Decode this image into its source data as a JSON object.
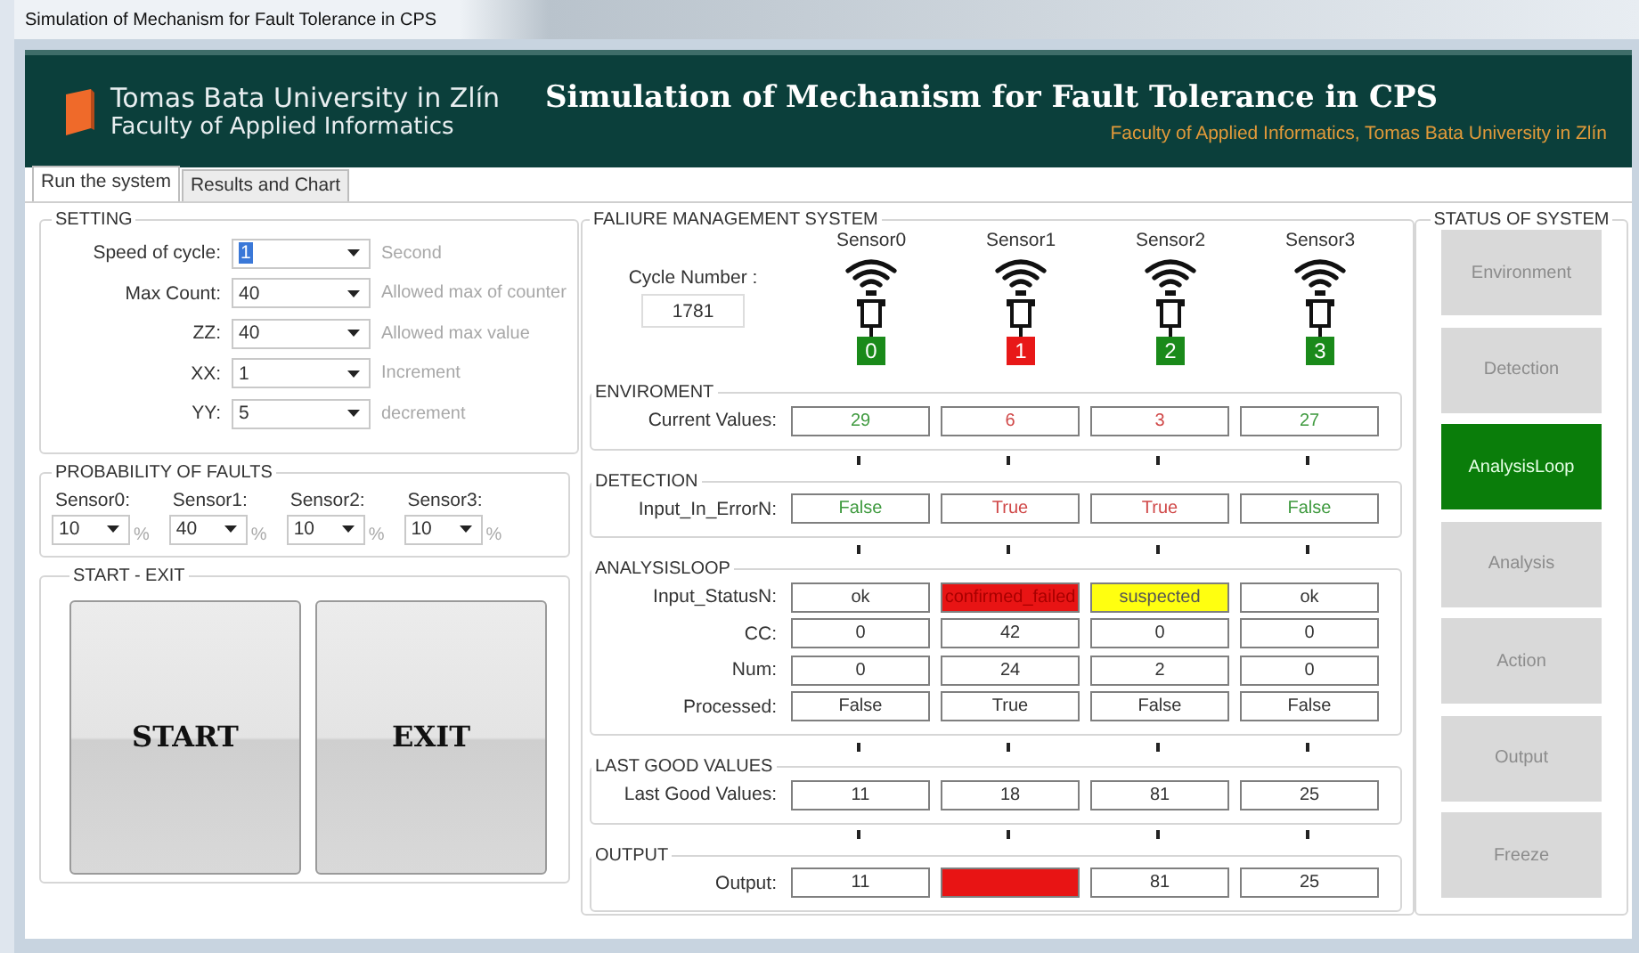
{
  "window": {
    "title": "Simulation of Mechanism for Fault Tolerance in CPS"
  },
  "header": {
    "university": "Tomas Bata University in Zlín",
    "faculty": "Faculty of Applied Informatics",
    "title": "Simulation of Mechanism for Fault Tolerance in CPS",
    "subtitle": "Faculty of Applied Informatics, Tomas Bata University in Zlín"
  },
  "tabs": [
    {
      "label": "Run the system",
      "selected": true
    },
    {
      "label": "Results and Chart",
      "selected": false
    }
  ],
  "setting": {
    "title": "SETTING",
    "fields": [
      {
        "label": "Speed of cycle:",
        "value": "1",
        "hint": "Second",
        "highlighted": true
      },
      {
        "label": "Max Count:",
        "value": "40",
        "hint": "Allowed max of counter",
        "highlighted": false
      },
      {
        "label": "ZZ:",
        "value": "40",
        "hint": "Allowed max value",
        "highlighted": false
      },
      {
        "label": "XX:",
        "value": "1",
        "hint": "Increment",
        "highlighted": false
      },
      {
        "label": "YY:",
        "value": "5",
        "hint": "decrement",
        "highlighted": false
      }
    ]
  },
  "probability": {
    "title": "PROBABILITY OF FAULTS",
    "sensors": [
      {
        "label": "Sensor0:",
        "value": "10",
        "unit": "%"
      },
      {
        "label": "Sensor1:",
        "value": "40",
        "unit": "%"
      },
      {
        "label": "Sensor2:",
        "value": "10",
        "unit": "%"
      },
      {
        "label": "Sensor3:",
        "value": "10",
        "unit": "%"
      }
    ]
  },
  "start_exit": {
    "title": "START - EXIT",
    "buttons": [
      "START",
      "EXIT"
    ]
  },
  "fms": {
    "title": "FALIURE MANAGEMENT SYSTEM",
    "cycle_label": "Cycle Number :",
    "cycle_value": "1781",
    "sensors": [
      {
        "name": "Sensor0",
        "number": "0",
        "color": "#1a8a1a"
      },
      {
        "name": "Sensor1",
        "number": "1",
        "color": "#e81818"
      },
      {
        "name": "Sensor2",
        "number": "2",
        "color": "#1a8a1a"
      },
      {
        "name": "Sensor3",
        "number": "3",
        "color": "#1a8a1a"
      }
    ],
    "sections": [
      {
        "title": "ENVIROMENT",
        "rows": [
          {
            "label": "Current Values:",
            "cells": [
              {
                "text": "29",
                "kind": "good"
              },
              {
                "text": "6",
                "kind": "bad"
              },
              {
                "text": "3",
                "kind": "bad"
              },
              {
                "text": "27",
                "kind": "good"
              }
            ]
          }
        ]
      },
      {
        "title": "DETECTION",
        "rows": [
          {
            "label": "Input_In_ErrorN:",
            "cells": [
              {
                "text": "False",
                "kind": "good"
              },
              {
                "text": "True",
                "kind": "bad"
              },
              {
                "text": "True",
                "kind": "bad"
              },
              {
                "text": "False",
                "kind": "good"
              }
            ]
          }
        ]
      },
      {
        "title": "ANALYSISLOOP",
        "rows": [
          {
            "label": "Input_StatusN:",
            "cells": [
              {
                "text": "ok",
                "kind": "plain"
              },
              {
                "text": "confirmed_failed",
                "kind": "failed"
              },
              {
                "text": "suspected",
                "kind": "suspect"
              },
              {
                "text": "ok",
                "kind": "plain"
              }
            ]
          },
          {
            "label": "CC:",
            "cells": [
              {
                "text": "0",
                "kind": "plain"
              },
              {
                "text": "42",
                "kind": "plain"
              },
              {
                "text": "0",
                "kind": "plain"
              },
              {
                "text": "0",
                "kind": "plain"
              }
            ]
          },
          {
            "label": "Num:",
            "cells": [
              {
                "text": "0",
                "kind": "plain"
              },
              {
                "text": "24",
                "kind": "plain"
              },
              {
                "text": "2",
                "kind": "plain"
              },
              {
                "text": "0",
                "kind": "plain"
              }
            ]
          },
          {
            "label": "Processed:",
            "cells": [
              {
                "text": "False",
                "kind": "plain"
              },
              {
                "text": "True",
                "kind": "plain"
              },
              {
                "text": "False",
                "kind": "plain"
              },
              {
                "text": "False",
                "kind": "plain"
              }
            ]
          }
        ]
      },
      {
        "title": "LAST GOOD VALUES",
        "rows": [
          {
            "label": "Last Good Values:",
            "cells": [
              {
                "text": "11",
                "kind": "plain"
              },
              {
                "text": "18",
                "kind": "plain"
              },
              {
                "text": "81",
                "kind": "plain"
              },
              {
                "text": "25",
                "kind": "plain"
              }
            ]
          }
        ]
      },
      {
        "title": "OUTPUT",
        "rows": [
          {
            "label": "Output:",
            "cells": [
              {
                "text": "11",
                "kind": "plain"
              },
              {
                "kind": "failed"
              },
              {
                "text": "81",
                "kind": "plain"
              },
              {
                "text": "25",
                "kind": "plain"
              }
            ]
          }
        ]
      }
    ]
  },
  "status": {
    "title": "STATUS OF SYSTEM",
    "items": [
      {
        "label": "Environment",
        "selected": false
      },
      {
        "label": "Detection",
        "selected": false
      },
      {
        "label": "AnalysisLoop",
        "selected": true
      },
      {
        "label": "Analysis",
        "selected": false
      },
      {
        "label": "Action",
        "selected": false
      },
      {
        "label": "Output",
        "selected": false
      },
      {
        "label": "Freeze",
        "selected": false
      }
    ]
  }
}
